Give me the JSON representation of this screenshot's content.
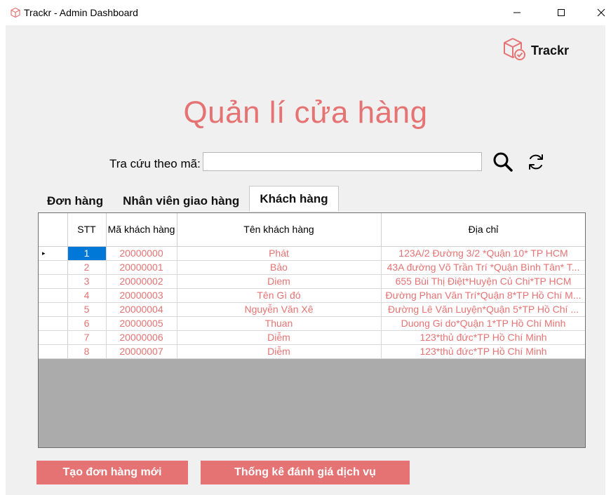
{
  "window": {
    "title": "Trackr - Admin Dashboard",
    "icon": "package-icon"
  },
  "brand": {
    "name": "Trackr",
    "icon": "package-check-icon"
  },
  "page": {
    "title": "Quản lí cửa hàng"
  },
  "search": {
    "label": "Tra cứu theo mã:",
    "value": "",
    "placeholder": ""
  },
  "tabs": [
    {
      "label": "Đơn hàng"
    },
    {
      "label": "Nhân viên giao hàng"
    },
    {
      "label": "Khách hàng"
    }
  ],
  "grid": {
    "columns": [
      "STT",
      "Mã khách hàng",
      "Tên khách hàng",
      "Địa chỉ"
    ],
    "rows": [
      {
        "stt": "1",
        "ma": "20000000",
        "ten": "Phát",
        "dia_chi": "123A/2 Đường 3/2 *Quận 10* TP HCM"
      },
      {
        "stt": "2",
        "ma": "20000001",
        "ten": "Bảo",
        "dia_chi": "43A đường Võ Trần Trí *Quận Bình Tân* T..."
      },
      {
        "stt": "3",
        "ma": "20000002",
        "ten": "Diem",
        "dia_chi": "655 Bùi Thị Điệt*Huyện Củ Chi*TP HCM"
      },
      {
        "stt": "4",
        "ma": "20000003",
        "ten": "Tên Gì đó",
        "dia_chi": "Đường Phan Văn Trí*Quận 8*TP Hồ Chí M..."
      },
      {
        "stt": "5",
        "ma": "20000004",
        "ten": "Nguyễn Văn Xê",
        "dia_chi": "Đường Lê Văn Luyện*Quận 5*TP Hồ Chí ..."
      },
      {
        "stt": "6",
        "ma": "20000005",
        "ten": "Thuan",
        "dia_chi": "Duong Gi do*Quận 1*TP Hồ Chí Minh"
      },
      {
        "stt": "7",
        "ma": "20000006",
        "ten": "Diễm",
        "dia_chi": "123*thủ đức*TP Hồ Chí Minh"
      },
      {
        "stt": "8",
        "ma": "20000007",
        "ten": "Diễm",
        "dia_chi": "123*thủ đức*TP Hồ Chí Minh"
      }
    ]
  },
  "buttons": {
    "create_order": "Tạo đơn hàng mới",
    "service_stats": "Thống kê đánh giá dịch vụ"
  },
  "colors": {
    "accent": "#e57373",
    "selection": "#0078d7",
    "grid_empty": "#ababab",
    "background": "#f0f0f0"
  }
}
